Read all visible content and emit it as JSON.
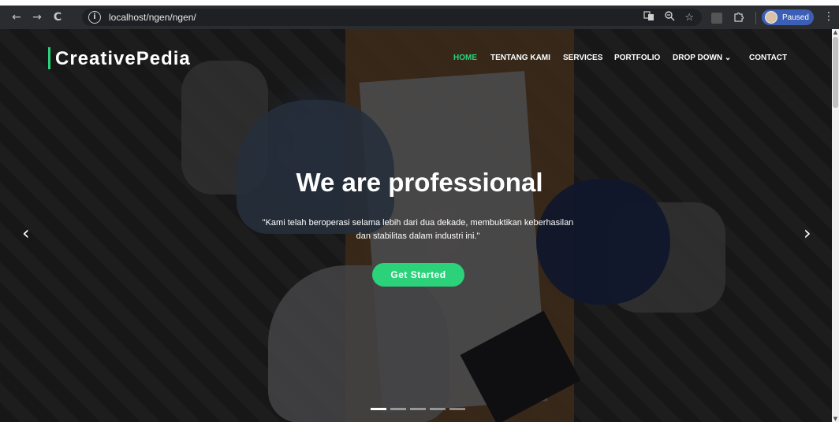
{
  "browser": {
    "back": "←",
    "forward": "→",
    "reload": "C",
    "url": "localhost/ngen/ngen/",
    "profile_label": "Paused",
    "icons": [
      "translate-icon",
      "zoom-icon",
      "star-icon",
      "extensions-icon",
      "puzzle-icon",
      "menu-icon"
    ]
  },
  "site": {
    "logo": "CreativePedia",
    "nav": [
      {
        "label": "HOME",
        "active": true
      },
      {
        "label": "TENTANG KAMI",
        "active": false
      },
      {
        "label": "SERVICES",
        "active": false
      },
      {
        "label": "PORTFOLIO",
        "active": false
      },
      {
        "label": "DROP DOWN ⌄",
        "active": false
      },
      {
        "label": "CONTACT",
        "active": false
      }
    ]
  },
  "hero": {
    "title": "We are professional",
    "subtitle": "\"Kami telah beroperasi selama lebih dari dua dekade, membuktikan keberhasilan dan stabilitas dalam industri ini.\"",
    "cta": "Get Started",
    "prev_arrow": "‹",
    "next_arrow": "›",
    "slide_count": 5,
    "active_slide": 1
  },
  "colors": {
    "accent": "#2bd27a",
    "chrome": "#2b2c2f",
    "profile": "#3c5fb5"
  }
}
